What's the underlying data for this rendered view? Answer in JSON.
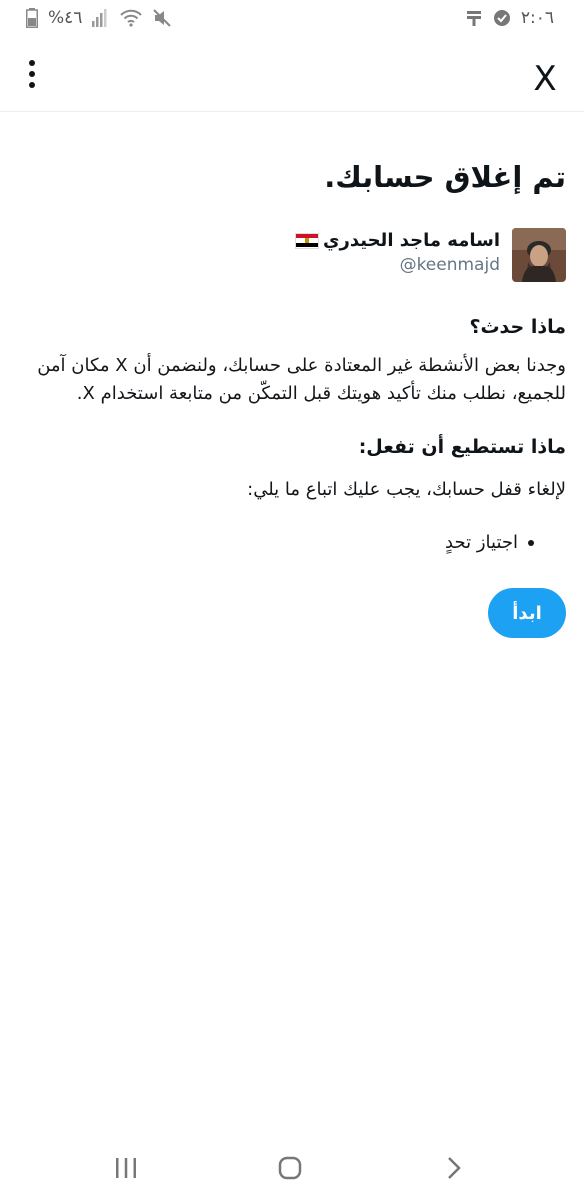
{
  "status_bar": {
    "time": "٢:٠٦",
    "battery": "%٤٦"
  },
  "icons": {
    "menu": "overflow-menu-icon",
    "close": "x-logo-icon",
    "avatar": "profile-picture",
    "flag": "egypt-flag-icon"
  },
  "colors": {
    "accent": "#1da1f2",
    "text": "#0f1419",
    "muted": "#657786",
    "flag_red": "#ce1126",
    "flag_white": "#ffffff",
    "flag_black": "#000000",
    "flag_eagle": "#c09300"
  },
  "page": {
    "title": "تم إغلاق حسابك."
  },
  "account": {
    "name": "اسامه ماجد الحيدري",
    "handle": "@keenmajd"
  },
  "what_happened": {
    "heading": "ماذا حدث؟",
    "body": "وجدنا بعض الأنشطة غير المعتادة على حسابك، ولنضمن أن X مكان آمن للجميع، نطلب منك تأكيد هويتك قبل التمكّن من متابعة استخدام X."
  },
  "what_to_do": {
    "heading": "ماذا تستطيع أن تفعل:",
    "body": "لإلغاء قفل حسابك، يجب عليك اتباع ما يلي:",
    "steps": [
      "اجتياز تحدٍ"
    ]
  },
  "actions": {
    "start": "ابدأ"
  }
}
